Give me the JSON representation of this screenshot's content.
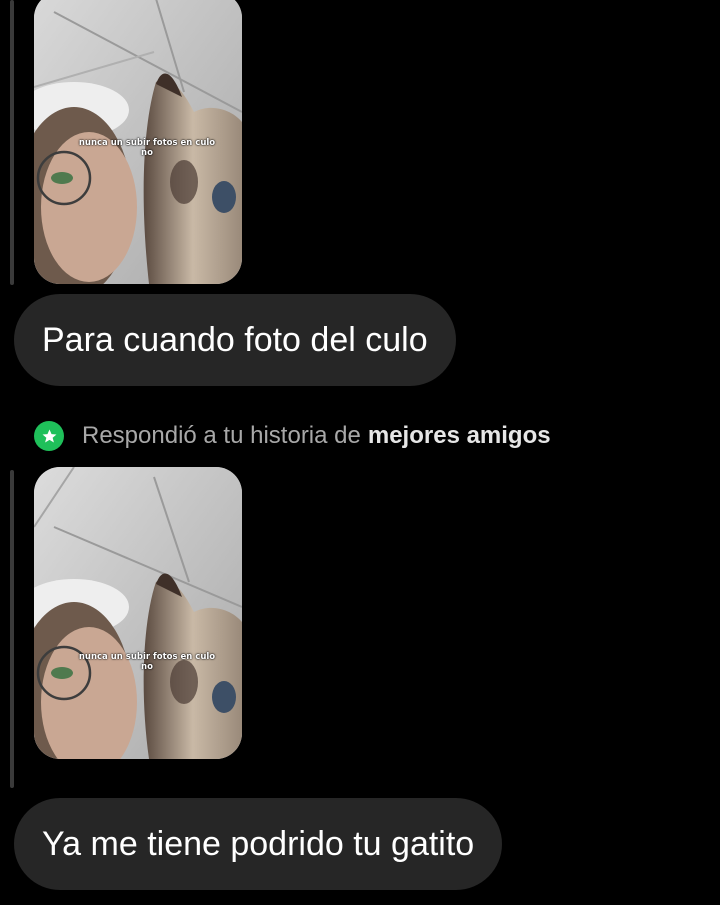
{
  "thread": {
    "messages": [
      {
        "story_caption_line1": "nunca un subir fotos en culo",
        "story_caption_line2": "no",
        "text": "Para cuando foto del culo"
      },
      {
        "story_caption_line1": "nunca un subir fotos en culo",
        "story_caption_line2": "no",
        "text": "Ya me tiene podrido tu gatito"
      }
    ],
    "reply_label": {
      "prefix": "Respondió a tu historia de",
      "emphasis": "mejores amigos",
      "icon": "star-icon",
      "badge_color": "#1fc05a"
    }
  },
  "colors": {
    "background": "#000000",
    "bubble": "#262626",
    "muted_text": "#a8a8a8"
  }
}
